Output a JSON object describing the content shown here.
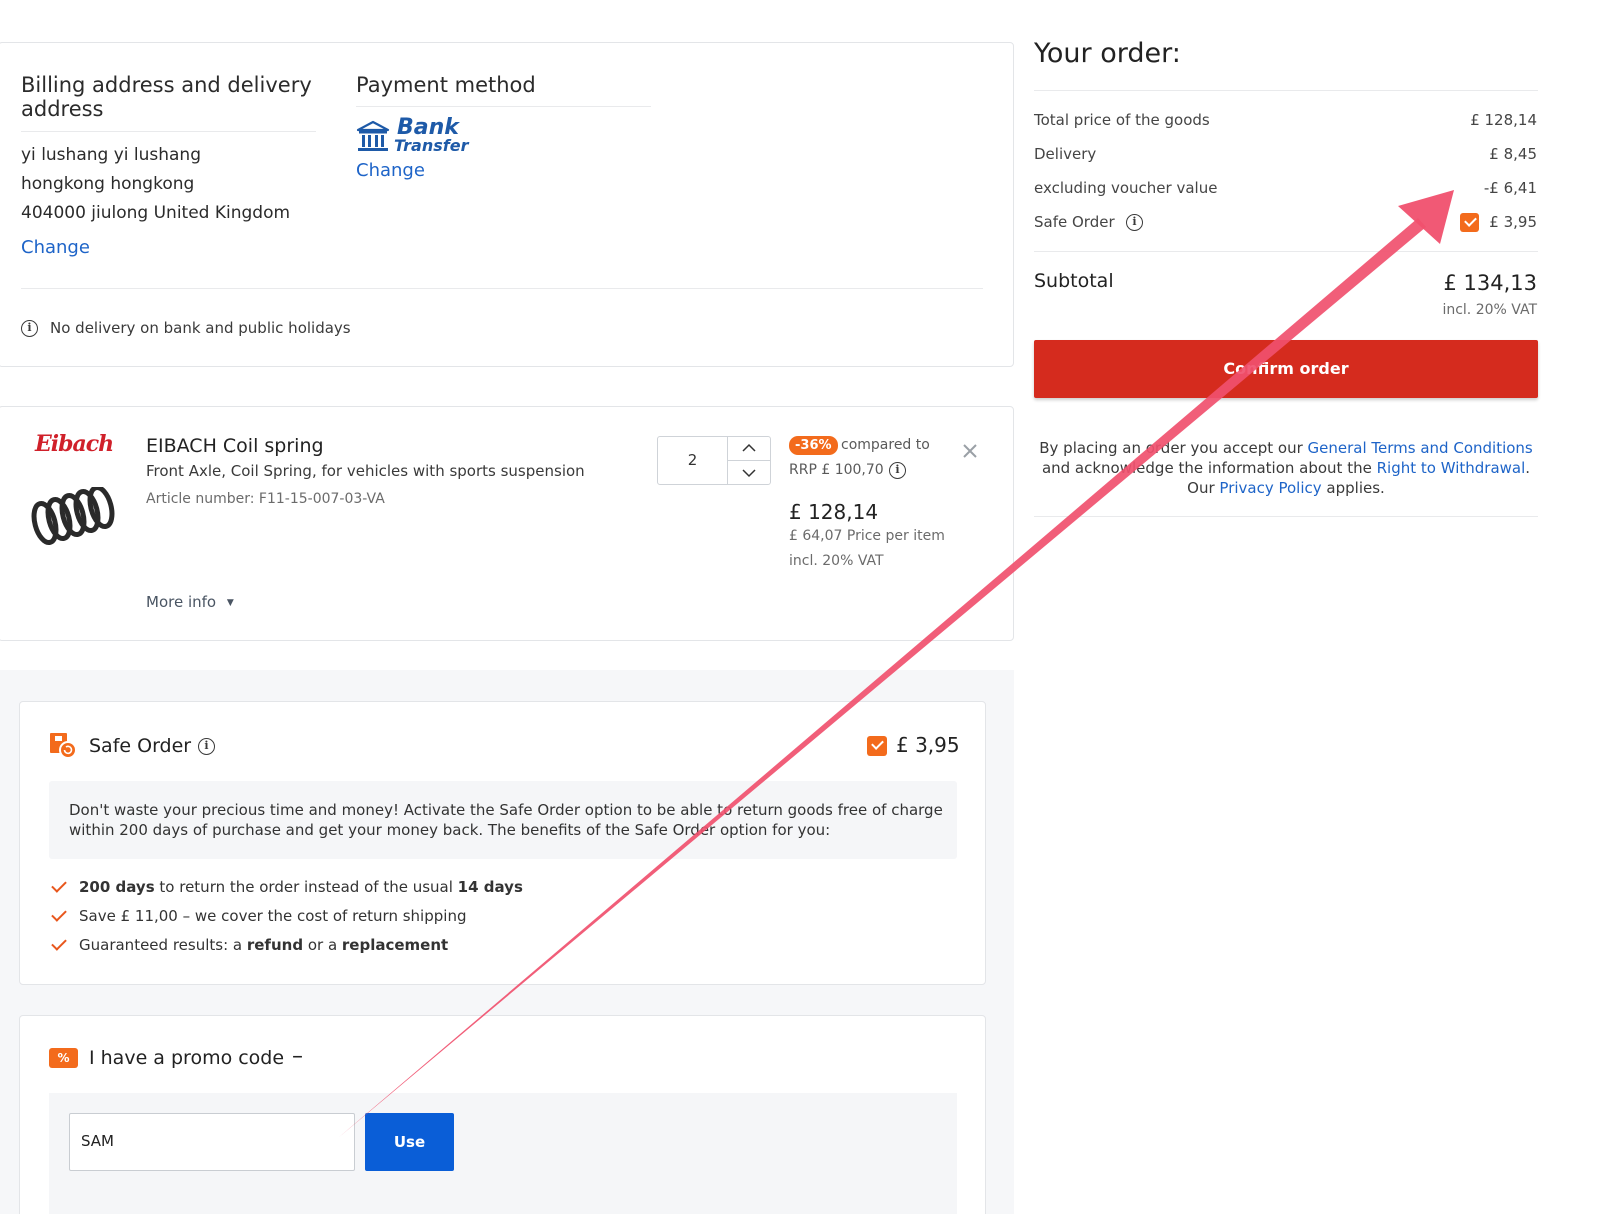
{
  "billing": {
    "title": "Billing address and delivery address",
    "lines": [
      "yi lushang yi lushang",
      "hongkong hongkong",
      "404000 jiulong United Kingdom"
    ],
    "change_label": "Change"
  },
  "payment": {
    "title": "Payment method",
    "method_line1": "Bank",
    "method_line2": "Transfer",
    "change_label": "Change"
  },
  "delivery_note": "No delivery on bank and public holidays",
  "item": {
    "brand_logo": "Eibach",
    "name": "EIBACH Coil spring",
    "description": "Front Axle, Coil Spring, for vehicles with sports suspension",
    "article": "Article number: F11-15-007-03-VA",
    "more_info": "More info",
    "quantity": "2",
    "discount_badge": "-36%",
    "compared_to": "compared to",
    "rrp": "RRP £ 100,70",
    "price": "£ 128,14",
    "per_item": "£ 64,07 Price per item",
    "vat": "incl. 20% VAT"
  },
  "safe_order": {
    "title": "Safe Order",
    "price": "£ 3,95",
    "description": "Don't waste your precious time and money! Activate the Safe Order option to be able to return goods free of charge within 200 days of purchase and get your money back. The benefits of the Safe Order option for you:",
    "benefit1_strong": "200 days",
    "benefit1_text": " to return the order instead of the usual ",
    "benefit1_strong2": "14 days",
    "benefit2": "Save £ 11,00 – we cover the cost of return shipping",
    "benefit3_text": "Guaranteed results: a ",
    "benefit3_strong1": "refund",
    "benefit3_mid": " or a ",
    "benefit3_strong2": "replacement"
  },
  "promo": {
    "title": "I have a promo code",
    "collapse_symbol": "–",
    "input_value": "SAM",
    "use_label": "Use"
  },
  "order": {
    "title": "Your order:",
    "rows": [
      {
        "label": "Total price of the goods",
        "value": "£ 128,14"
      },
      {
        "label": "Delivery",
        "value": "£ 8,45"
      },
      {
        "label": "excluding voucher value",
        "value": "-£ 6,41"
      },
      {
        "label": "Safe Order",
        "value": "£ 3,95"
      }
    ],
    "subtotal_label": "Subtotal",
    "subtotal_value": "£ 134,13",
    "subtotal_vat": "incl. 20% VAT",
    "confirm_label": "Confirm order",
    "legal_1": "By placing an order you accept our ",
    "legal_terms": "General Terms and Conditions",
    "legal_2": "and acknowledge the information about the ",
    "legal_withdrawal": "Right to Withdrawal",
    "legal_3": ".",
    "legal_4": "Our ",
    "legal_privacy": "Privacy Policy",
    "legal_5": " applies."
  },
  "colors": {
    "brand_orange": "#f36b1c",
    "confirm_red": "#d52b1e",
    "link_blue": "#1e64c8",
    "use_blue": "#0a5ed7",
    "annotation_arrow": "#f0506e"
  }
}
